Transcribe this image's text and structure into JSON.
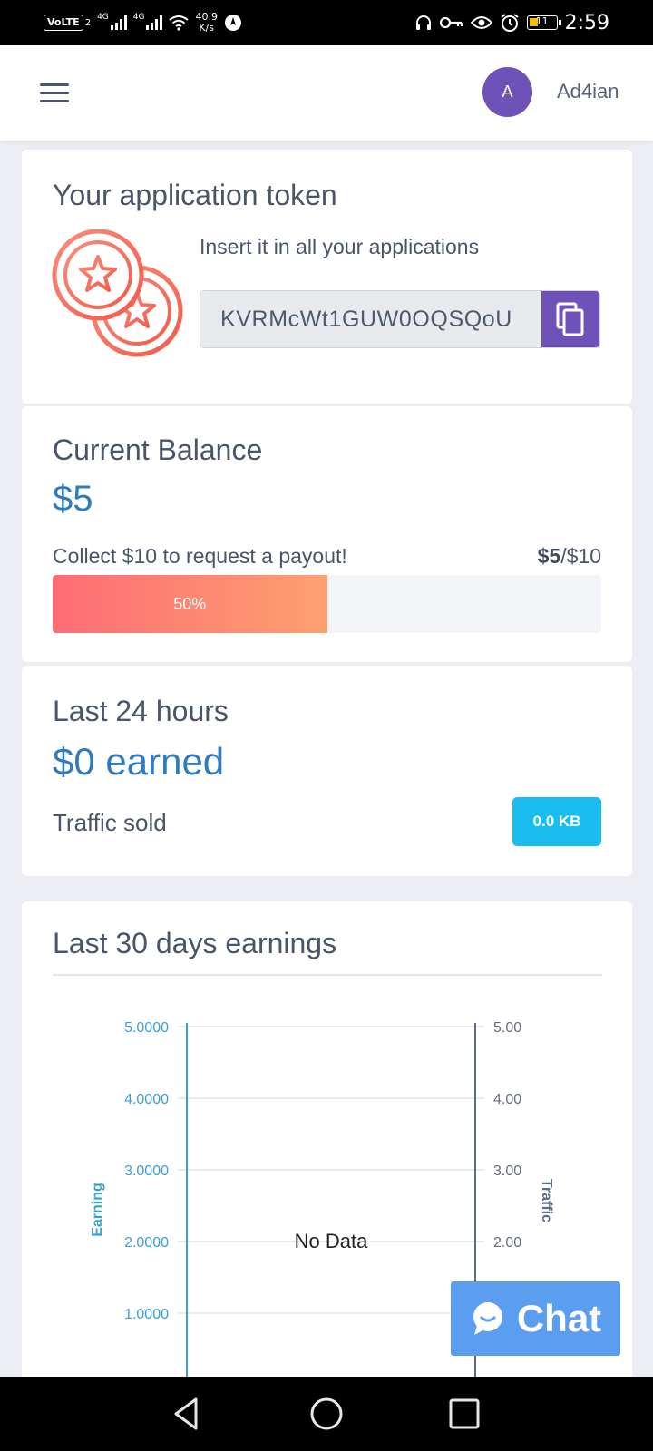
{
  "status_bar": {
    "volte": "VoLTE",
    "sim_slot": "2",
    "network_1": "4G",
    "network_2": "4G",
    "speed_value": "40.9",
    "speed_unit": "K/s",
    "battery": "11",
    "time": "2:59"
  },
  "header": {
    "avatar_letter": "A",
    "username": "Ad4ian"
  },
  "token_card": {
    "title": "Your application token",
    "instruction": "Insert it in all your applications",
    "token": "KVRMcWt1GUW0OQSQoU"
  },
  "balance_card": {
    "title": "Current Balance",
    "amount": "$5",
    "collect_text": "Collect $10 to request a payout!",
    "current": "$5",
    "target": "/$10",
    "progress_label": "50%",
    "progress_fraction": 0.5
  },
  "last24_card": {
    "title": "Last 24 hours",
    "earned": "$0 earned",
    "traffic_label": "Traffic sold",
    "traffic_value": "0.0 KB"
  },
  "last30_card": {
    "title": "Last 30 days earnings"
  },
  "chart_data": {
    "type": "line",
    "no_data_text": "No Data",
    "left_axis": {
      "label": "Earning",
      "ticks": [
        "5.0000",
        "4.0000",
        "3.0000",
        "2.0000",
        "1.0000"
      ],
      "ylim": [
        0,
        5
      ]
    },
    "right_axis": {
      "label": "Traffic",
      "ticks": [
        "5.00",
        "4.00",
        "3.00",
        "2.00"
      ],
      "ylim": [
        0,
        5
      ]
    },
    "series": [],
    "grid": true,
    "colors": {
      "left_axis": "#3aa0d4",
      "right_axis": "#5d6b8a"
    }
  },
  "chat": {
    "label": "Chat",
    "color": "#5b9ef0"
  },
  "colors": {
    "accent": "#6f52b8",
    "link_blue": "#2f7bbf",
    "badge": "#1bbcf0"
  }
}
